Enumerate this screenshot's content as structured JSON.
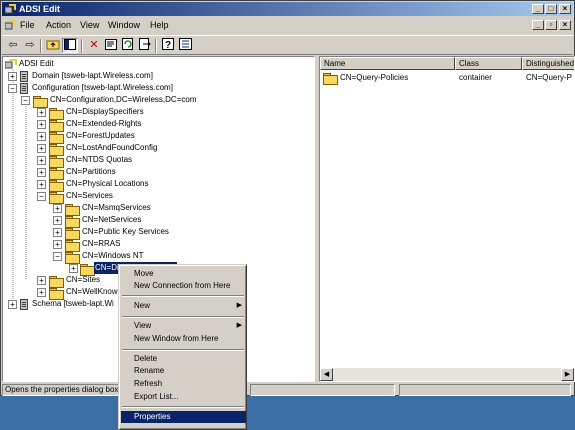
{
  "window": {
    "title": "ADSI Edit",
    "controls": {
      "minimize": "_",
      "maximize": "□",
      "close": "×"
    }
  },
  "menubar": {
    "items": [
      "File",
      "Action",
      "View",
      "Window",
      "Help"
    ],
    "mdi_controls": {
      "minimize": "_",
      "restore": "▫",
      "close": "×"
    }
  },
  "toolbar": {
    "icons": [
      "back-arrow-icon",
      "forward-arrow-icon",
      "up-folder-icon",
      "show-hide-tree-icon",
      "delete-icon",
      "properties-icon",
      "refresh-icon",
      "export-list-icon",
      "help-icon",
      "tree-view-icon"
    ]
  },
  "tree": {
    "items": [
      {
        "label": "ADSI Edit"
      },
      {
        "label": "Domain [tsweb-lapt.Wireless.com]"
      },
      {
        "label": "Configuration [tsweb-lapt.Wireless.com]"
      },
      {
        "label": "CN=Configuration,DC=Wireless,DC=com"
      },
      {
        "label": "CN=DisplaySpecifiers"
      },
      {
        "label": "CN=Extended-Rights"
      },
      {
        "label": "CN=ForestUpdates"
      },
      {
        "label": "CN=LostAndFoundConfig"
      },
      {
        "label": "CN=NTDS Quotas"
      },
      {
        "label": "CN=Partitions"
      },
      {
        "label": "CN=Physical Locations"
      },
      {
        "label": "CN=Services"
      },
      {
        "label": "CN=MsmqServices"
      },
      {
        "label": "CN=NetServices"
      },
      {
        "label": "CN=Public Key Services"
      },
      {
        "label": "CN=RRAS"
      },
      {
        "label": "CN=Windows NT"
      },
      {
        "label": "CN=Dir"
      },
      {
        "label": "CN=Sites"
      },
      {
        "label": "CN=WellKnown"
      },
      {
        "label": "Schema [tsweb-lapt.Wi"
      }
    ]
  },
  "list": {
    "columns": [
      "Name",
      "Class",
      "Distinguished"
    ],
    "rows": [
      {
        "name": "CN=Query-Policies",
        "class": "container",
        "dn": "CN=Query-P"
      }
    ]
  },
  "scroll": {
    "left": "◀",
    "right": "▶"
  },
  "statusbar": {
    "text": "Opens the properties dialog box"
  },
  "context_menu": {
    "items": [
      "Move",
      "New Connection from Here",
      "New",
      "View",
      "New Window from Here",
      "Delete",
      "Rename",
      "Refresh",
      "Export List...",
      "Properties"
    ],
    "submenu_arrow": "▶"
  }
}
